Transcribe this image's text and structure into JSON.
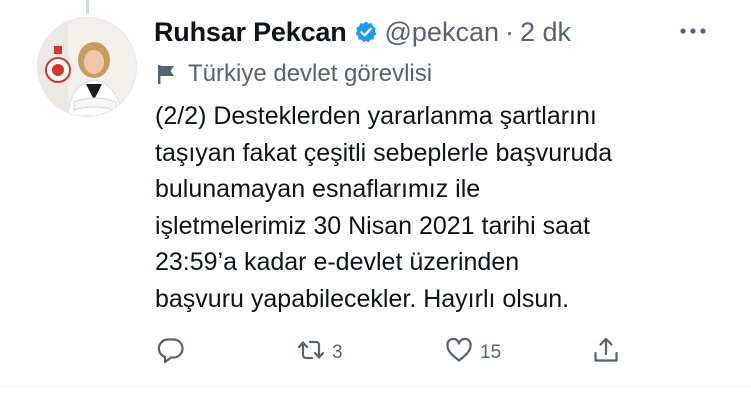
{
  "tweet": {
    "display_name": "Ruhsar Pekcan",
    "handle": "@pekcan",
    "separator": "·",
    "time": "2 dk",
    "label": "Türkiye devlet görevlisi",
    "text": "(2/2) Desteklerden yararlanma şartlarını\ntaşıyan fakat çeşitli sebeplerle başvuruda\nbulunamayan esnaflarımız ile\nişletmelerimiz 30 Nisan 2021 tarihi saat\n23:59’a kadar e-devlet üzerinden\nbaşvuru yapabilecekler. Hayırlı olsun.",
    "icons": {
      "verified": "verified-badge-icon",
      "label": "flag-icon",
      "more": "more-icon"
    }
  },
  "actions": {
    "reply": {
      "icon": "reply-icon",
      "count": ""
    },
    "retweet": {
      "icon": "retweet-icon",
      "count": "3"
    },
    "like": {
      "icon": "heart-icon",
      "count": "15"
    },
    "share": {
      "icon": "share-icon",
      "count": ""
    }
  },
  "colors": {
    "text_primary": "#0f1419",
    "text_secondary": "#536471",
    "verified_blue": "#1d9bf0",
    "divider": "#eff3f4"
  }
}
